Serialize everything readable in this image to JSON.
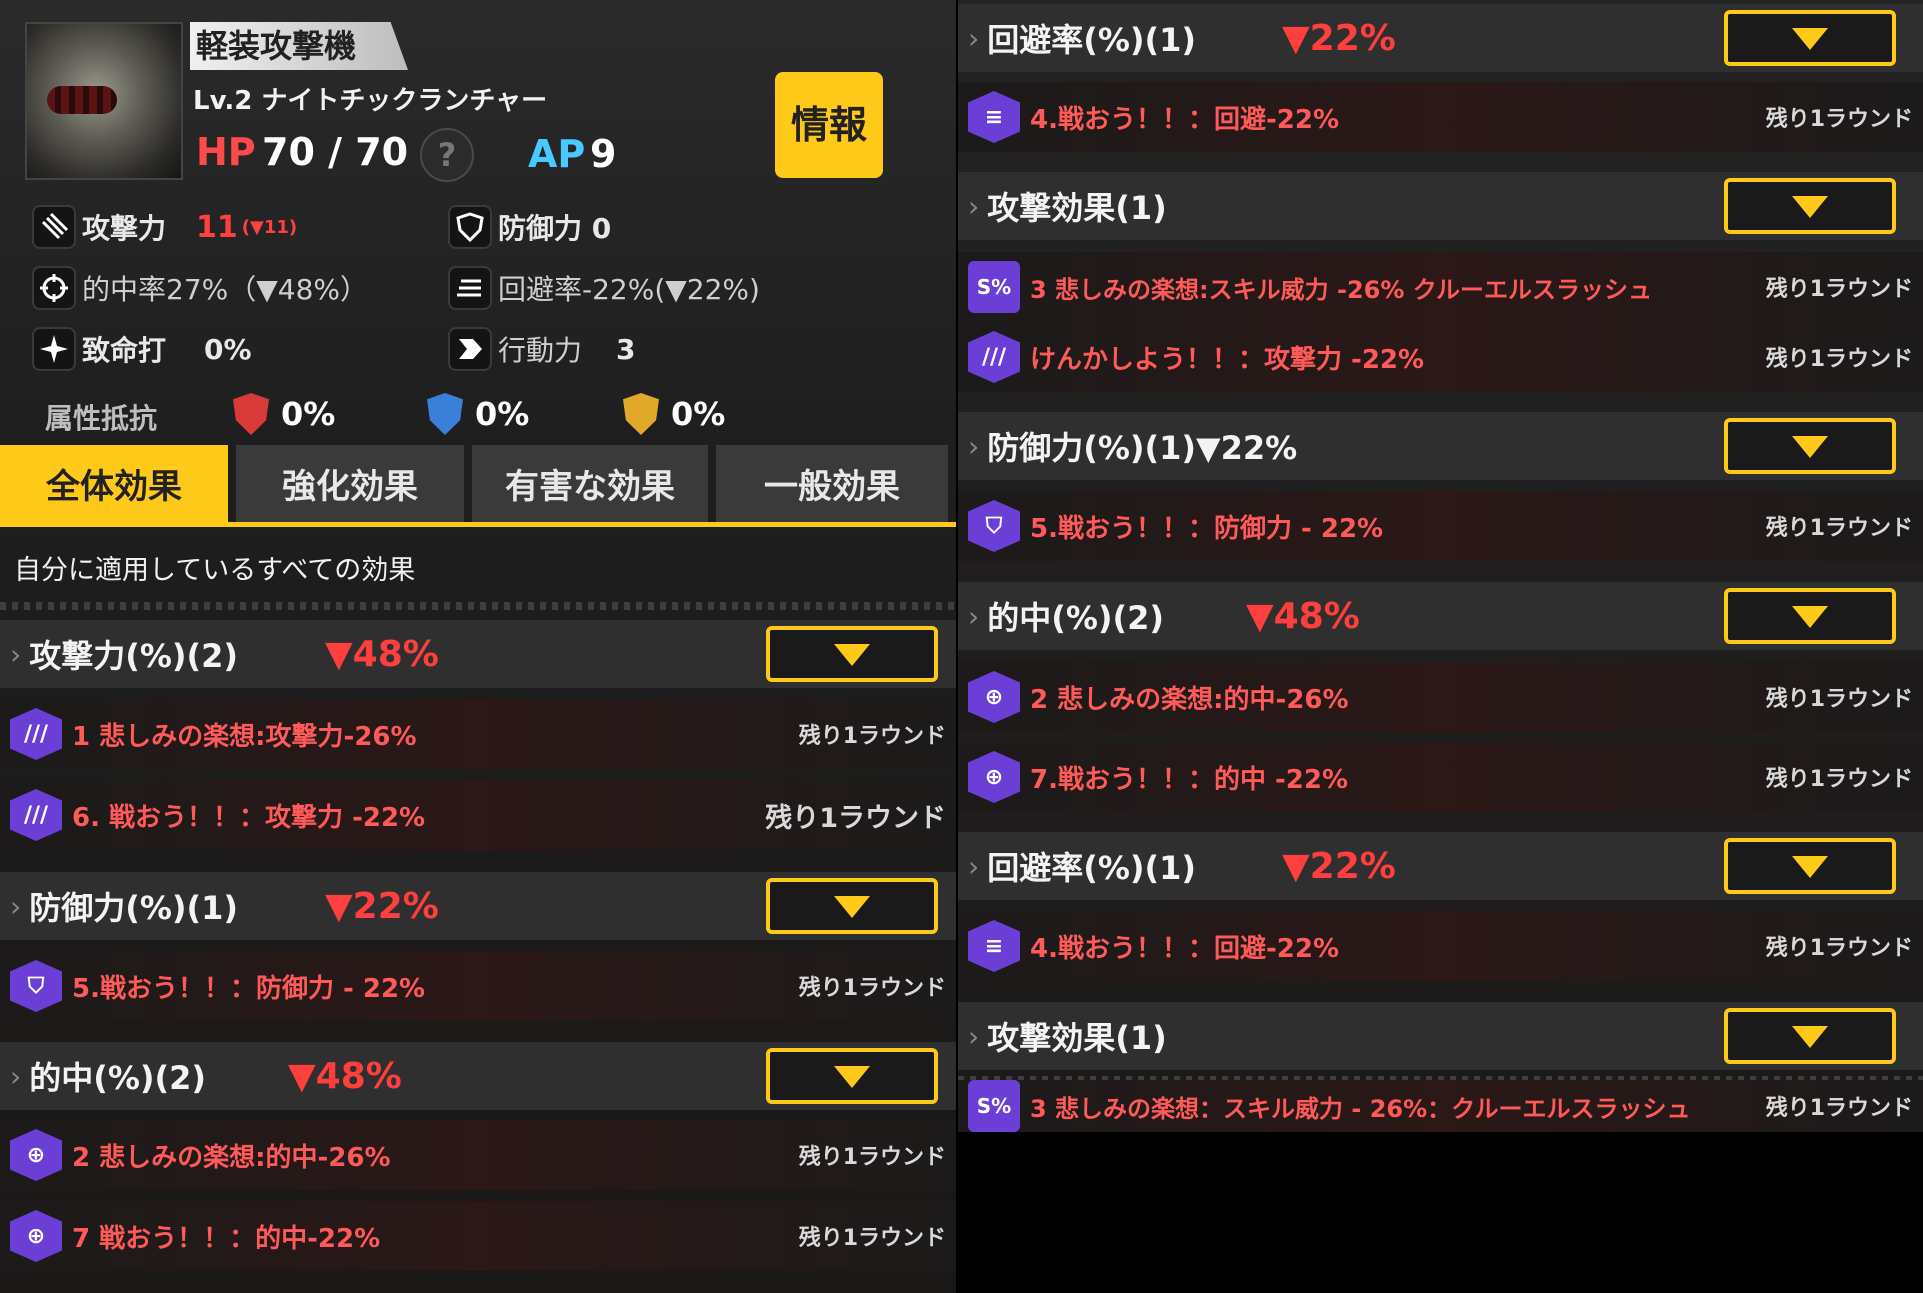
{
  "unit": {
    "type": "軽装攻撃機",
    "name": "Lv.2 ナイトチックランチャー",
    "hp_label": "HP",
    "hp_value": "70 / 70",
    "help": "?",
    "ap_label": "AP",
    "ap_value": "9",
    "info_button": "情報"
  },
  "stats": {
    "attack_label": "攻撃力",
    "attack_value": "11",
    "attack_delta": "(▼11)",
    "defense_label": "防御力 0",
    "accuracy_label": "的中率27%（▼48%）",
    "evasion_label": "回避率-22%(▼22%)",
    "crit_label": "致命打",
    "crit_value": "0%",
    "action_label": "行動力",
    "action_value": "3"
  },
  "resist": {
    "label": "属性抵抗",
    "fire": "0%",
    "water": "0%",
    "thunder": "0%"
  },
  "tabs": [
    "全体効果",
    "強化効果",
    "有害な効果",
    "一般効果"
  ],
  "tab_description": "自分に適用しているすべての効果",
  "left_groups": [
    {
      "title": "攻撃力(%)(2)",
      "pct": "▼48%",
      "effects": [
        {
          "text": "1 悲しみの楽想:攻撃力-26%",
          "remain": "残り1ラウンド"
        },
        {
          "text": "6. 戦おう！！：攻撃力 -22%",
          "remain": "残り1ラウンド"
        }
      ]
    },
    {
      "title": "防御力(%)(1)",
      "pct": "▼22%",
      "effects": [
        {
          "text": "5.戦おう！！：防御力 - 22%",
          "remain": "残り1ラウンド"
        }
      ]
    },
    {
      "title": "的中(%)(2)",
      "pct": "▼48%",
      "effects": [
        {
          "text": "2 悲しみの楽想:的中-26%",
          "remain": "残り1ラウンド"
        },
        {
          "text": "7 戦おう！！：的中-22%",
          "remain": "残り1ラウンド"
        }
      ]
    }
  ],
  "right_groups": [
    {
      "title": "回避率(%)(1)",
      "pct": "▼22%",
      "effects": [
        {
          "text": "4.戦おう！！：回避-22%",
          "remain": "残り1ラウンド"
        }
      ]
    },
    {
      "title": "攻撃効果(1)",
      "pct": "",
      "effects": [
        {
          "text": "3 悲しみの楽想:スキル威力 -26% クルーエルスラッシュ",
          "remain": "残り1ラウンド"
        },
        {
          "text": "けんかしよう！！：攻撃力 -22%",
          "remain": "残り1ラウンド"
        }
      ]
    },
    {
      "title": "防御力(%)(1)▼22%",
      "pct": "",
      "effects": [
        {
          "text": "5.戦おう！！：防御力 - 22%",
          "remain": "残り1ラウンド"
        }
      ]
    },
    {
      "title": "的中(%)(2)",
      "pct": "▼48%",
      "effects": [
        {
          "text": "2 悲しみの楽想:的中-26%",
          "remain": "残り1ラウンド"
        },
        {
          "text": "7.戦おう！！：的中 -22%",
          "remain": "残り1ラウンド"
        }
      ]
    },
    {
      "title": "回避率(%)(1)",
      "pct": "▼22%",
      "effects": [
        {
          "text": "4.戦おう！！：回避-22%",
          "remain": "残り1ラウンド"
        }
      ]
    },
    {
      "title": "攻撃効果(1)",
      "pct": "",
      "effects": [
        {
          "text": "3 悲しみの楽想：スキル威力 - 26%：クルーエルスラッシュ",
          "remain": "残り1ラウンド"
        }
      ]
    }
  ],
  "icons": {
    "attack": "claw-icon",
    "defense": "shield-icon",
    "accuracy": "crosshair-icon",
    "evasion": "evasion-lines-icon",
    "crit": "star-burst-icon",
    "action": "arrow-icon",
    "skill": "skill-icon"
  },
  "colors": {
    "accent": "#ffc91a",
    "debuff": "#ff3e3e",
    "hp": "#ff4a4a",
    "ap": "#48c9ff",
    "effect_icon": "#6b3fd6"
  }
}
